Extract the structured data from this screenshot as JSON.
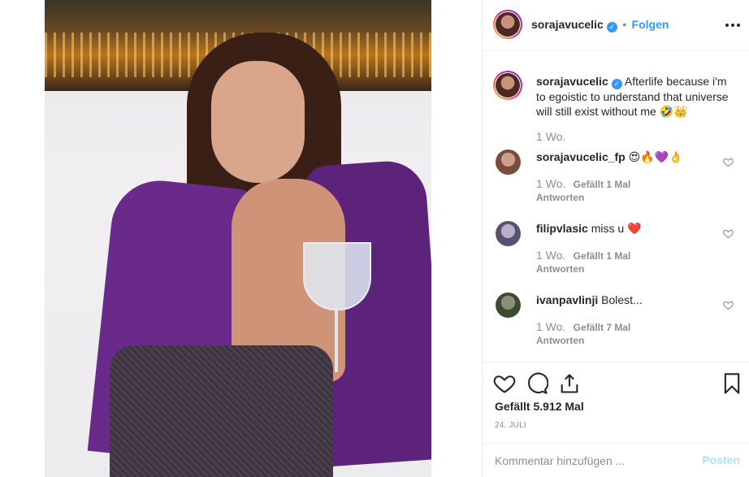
{
  "header": {
    "username": "sorajavucelic",
    "separator": "•",
    "follow_label": "Folgen"
  },
  "caption": {
    "username": "sorajavucelic",
    "text": "Afterlife because i'm to egoistic to understand that universe will still exist without me",
    "emojis": "🤣👑",
    "time": "1 Wo."
  },
  "comments": [
    {
      "username": "sorajavucelic_fp",
      "text": "",
      "emojis": "😍🔥💜👌",
      "time": "1 Wo.",
      "likes": "Gefällt 1 Mal",
      "reply": "Antworten",
      "avatar_color": "#7a4a3a"
    },
    {
      "username": "filipvlasic",
      "text": "miss u",
      "emojis": "❤️",
      "time": "1 Wo.",
      "likes": "Gefällt 1 Mal",
      "reply": "Antworten",
      "avatar_color": "#8a7fa0"
    },
    {
      "username": "ivanpavlinji",
      "text": "Bolest...",
      "emojis": "",
      "time": "1 Wo.",
      "likes": "Gefällt 7 Mal",
      "reply": "Antworten",
      "avatar_color": "#4b5a3a"
    }
  ],
  "actions": {
    "likes": "Gefällt 5.912 Mal",
    "date": "24. JULI"
  },
  "comment_box": {
    "placeholder": "Kommentar hinzufügen ...",
    "post_label": "Posten"
  },
  "colors": {
    "accent": "#3897f0",
    "post_disabled": "#b2dffc",
    "text": "#262626",
    "muted": "#8e8e8e"
  }
}
